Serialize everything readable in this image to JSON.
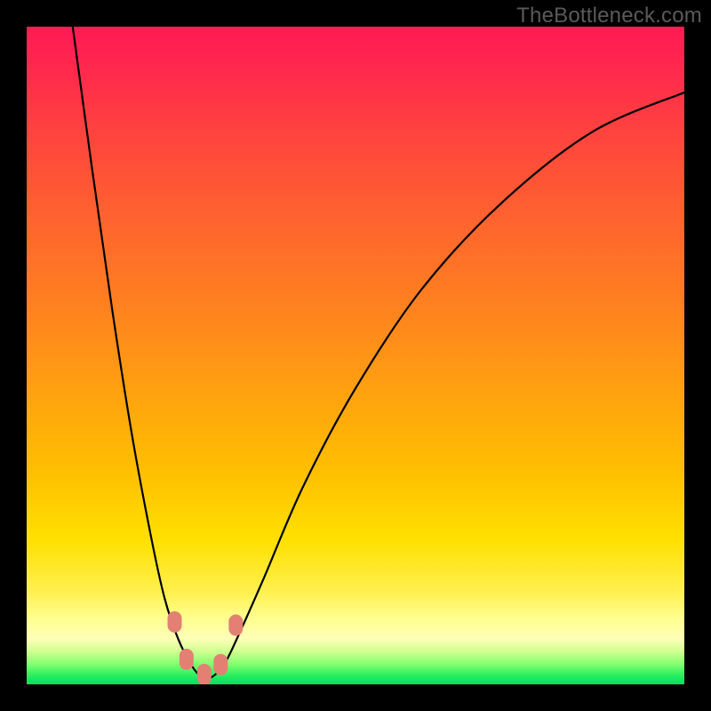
{
  "watermark": "TheBottleneck.com",
  "chart_data": {
    "type": "line",
    "title": "",
    "xlabel": "",
    "ylabel": "",
    "xlim": [
      0,
      100
    ],
    "ylim": [
      0,
      100
    ],
    "grid": false,
    "series": [
      {
        "name": "bottleneck-curve",
        "x": [
          7,
          10,
          13,
          16,
          19,
          21,
          23,
          25,
          26.7,
          28,
          30,
          32,
          36,
          42,
          50,
          60,
          72,
          86,
          100
        ],
        "values": [
          100,
          78,
          57,
          38,
          22,
          13,
          7,
          3,
          1,
          1,
          3,
          7,
          16,
          30,
          45,
          60,
          73,
          84,
          90
        ]
      }
    ],
    "markers": [
      {
        "x": 22.5,
        "y": 9.5
      },
      {
        "x": 24.3,
        "y": 3.8
      },
      {
        "x": 27.0,
        "y": 1.5
      },
      {
        "x": 29.5,
        "y": 3.0
      },
      {
        "x": 31.8,
        "y": 9.0
      }
    ],
    "marker_color": "#e38073",
    "curve_color": "#000000",
    "background_gradient": [
      "#ff1a54",
      "#ff6030",
      "#ffc000",
      "#ffff90",
      "#00e060"
    ]
  }
}
